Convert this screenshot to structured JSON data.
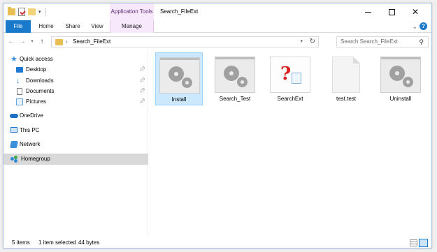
{
  "window": {
    "title": "Search_FileExt",
    "context_tab": "Application Tools"
  },
  "quick_access_toolbar": {
    "items": [
      "folder-icon",
      "properties-icon",
      "new-folder-icon",
      "dropdown"
    ]
  },
  "ribbon": {
    "tabs": [
      {
        "label": "File",
        "active": true
      },
      {
        "label": "Home"
      },
      {
        "label": "Share"
      },
      {
        "label": "View"
      },
      {
        "label": "Manage"
      }
    ],
    "help": "?"
  },
  "address_bar": {
    "path": "Search_FileExt",
    "search_placeholder": "Search Search_FileExt"
  },
  "navigation_pane": {
    "items": [
      {
        "label": "Quick access",
        "icon": "star-icon"
      },
      {
        "label": "Desktop",
        "icon": "desktop-icon",
        "pinned": true
      },
      {
        "label": "Downloads",
        "icon": "downloads-icon",
        "pinned": true
      },
      {
        "label": "Documents",
        "icon": "documents-icon",
        "pinned": true
      },
      {
        "label": "Pictures",
        "icon": "pictures-icon",
        "pinned": true
      },
      {
        "label": "OneDrive",
        "icon": "onedrive-icon"
      },
      {
        "label": "This PC",
        "icon": "this-pc-icon"
      },
      {
        "label": "Network",
        "icon": "network-icon"
      },
      {
        "label": "Homegroup",
        "icon": "homegroup-icon",
        "selected": true
      }
    ]
  },
  "files": [
    {
      "name": "Install",
      "type": "application",
      "selected": true
    },
    {
      "name": "Search_Test",
      "type": "application"
    },
    {
      "name": "SearchExt",
      "type": "script"
    },
    {
      "name": "test.test",
      "type": "file"
    },
    {
      "name": "Uninstall",
      "type": "application"
    }
  ],
  "status_bar": {
    "item_count": "5 items",
    "selection": "1 item selected",
    "size": "44 bytes"
  },
  "colors": {
    "accent": "#1979ca",
    "context_tab_bg": "#f7e8fb",
    "selection_bg": "#cce8ff"
  }
}
